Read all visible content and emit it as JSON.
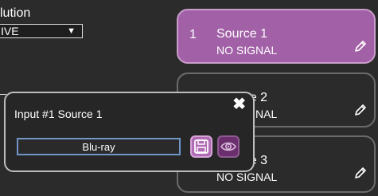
{
  "background": {
    "label": "lution",
    "select_value": "IVE"
  },
  "sources": [
    {
      "number": "1",
      "name": "Source 1",
      "status": "NO SIGNAL"
    },
    {
      "number": "2",
      "name": "Source 2",
      "status": "NO SIGNAL"
    },
    {
      "number": "3",
      "name": "Source 3",
      "status": "NO SIGNAL"
    }
  ],
  "popup": {
    "title": "Input #1  Source 1",
    "name_value": "Blu-ray"
  },
  "colors": {
    "active_card": "#a260a6",
    "save_button": "#b06cb4",
    "eye_button": "#6b2f6e",
    "input_border": "#6f96c6"
  }
}
